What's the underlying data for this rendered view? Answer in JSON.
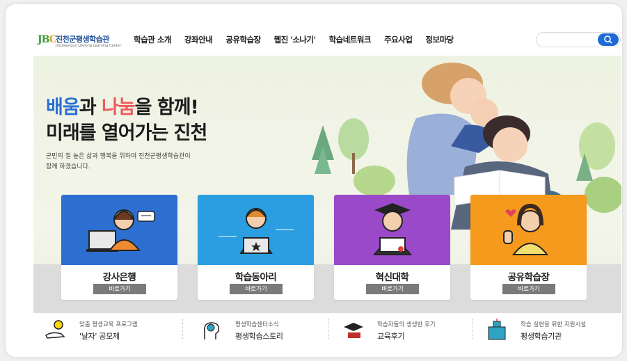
{
  "logo": {
    "mark": "JBC",
    "name": "진천군평생학습관",
    "sub": "Jincheongun Lifelong Learning Center"
  },
  "nav": {
    "items": [
      "학습관 소개",
      "강좌안내",
      "공유학습장",
      "웹진 '소나기'",
      "학습네트워크",
      "주요사업",
      "정보마당"
    ]
  },
  "search": {
    "placeholder": "",
    "icon": "search-icon"
  },
  "hero": {
    "line1_part1": "배움",
    "line1_part2": "과 ",
    "line1_part3": "나눔",
    "line1_part4": "을 함께!",
    "line2": "미래를 열어가는 진천",
    "sub1": "군민의 질 높은 삶과 행복을 위하여 진천군평생학습관이",
    "sub2": "함께 하겠습니다."
  },
  "cards": [
    {
      "title": "강사은행",
      "button": "바로가기",
      "color": "#2d6fd0"
    },
    {
      "title": "학습동아리",
      "button": "바로가기",
      "color": "#2a9ee0"
    },
    {
      "title": "혁신대학",
      "button": "바로가기",
      "color": "#9a4ac8"
    },
    {
      "title": "공유학습장",
      "button": "바로가기",
      "color": "#f59a1c"
    }
  ],
  "bottom_links": [
    {
      "small": "맞춤 평생교육 프로그램",
      "big": "'날자' 공모제",
      "icon": "lightbulb-hand-icon"
    },
    {
      "small": "평생학습센터소식",
      "big": "평생학습스토리",
      "icon": "globe-head-icon"
    },
    {
      "small": "학습자들의 생생한 후기",
      "big": "교육후기",
      "icon": "graduation-cap-icon"
    },
    {
      "small": "학습 실현을 위한 지원시설",
      "big": "평생학습기관",
      "icon": "building-icon"
    }
  ],
  "colors": {
    "accent_blue": "#2a6fd6",
    "accent_red": "#ef5a5a",
    "button_gray": "#7a7a7a"
  }
}
